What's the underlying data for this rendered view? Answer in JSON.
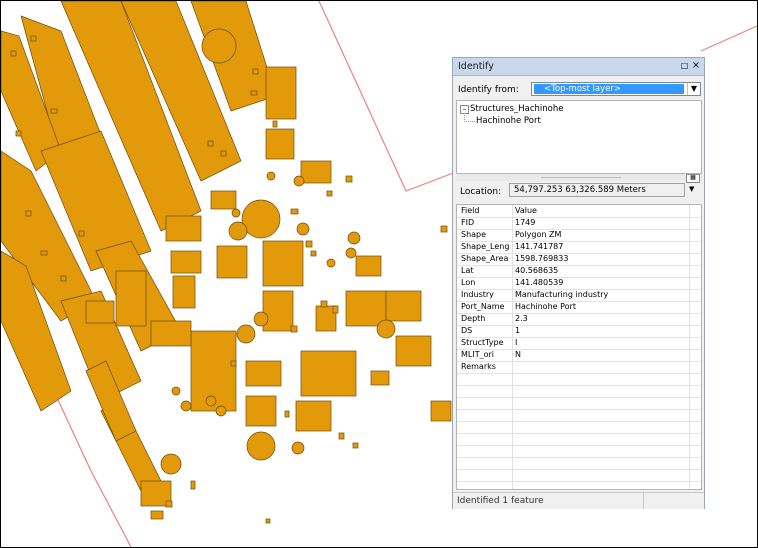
{
  "colors": {
    "building_fill": "#e39a0a",
    "building_stroke": "#6b4a10",
    "boundary_line": "#f08080",
    "highlight": "#3399ff"
  },
  "identify": {
    "title": "Identify",
    "dock_icon": "□",
    "close_icon": "×",
    "identify_from_label": "Identify from:",
    "identify_from_value": "<Top-most layer>",
    "tree": {
      "layer": "Structures_Hachinohe",
      "feature": "Hachinohe Port"
    },
    "location_label": "Location:",
    "location_value": "54,797.253  63,326.589 Meters",
    "table": {
      "header": {
        "field": "Field",
        "value": "Value"
      },
      "rows": [
        {
          "field": "FID",
          "value": "1749"
        },
        {
          "field": "Shape",
          "value": "Polygon ZM"
        },
        {
          "field": "Shape_Leng",
          "value": "141.741787"
        },
        {
          "field": "Shape_Area",
          "value": "1598.769833"
        },
        {
          "field": "Lat",
          "value": "40.568635"
        },
        {
          "field": "Lon",
          "value": "141.480539"
        },
        {
          "field": "Industry",
          "value": "Manufacturing industry"
        },
        {
          "field": "Port_Name",
          "value": "Hachinohe Port"
        },
        {
          "field": "Depth",
          "value": "2.3"
        },
        {
          "field": "DS",
          "value": "1"
        },
        {
          "field": "StructType",
          "value": "I"
        },
        {
          "field": "MLIT_ori",
          "value": "N"
        },
        {
          "field": "Remarks",
          "value": ""
        }
      ]
    },
    "status": "Identified 1 feature"
  }
}
